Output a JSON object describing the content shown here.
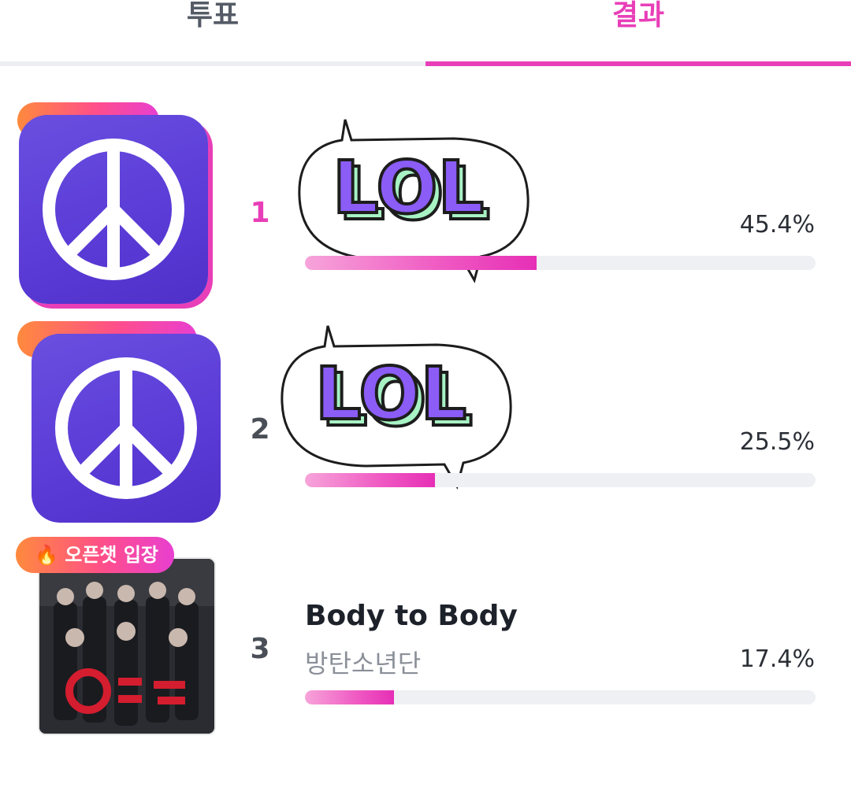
{
  "tabs": {
    "vote_label": "투표",
    "result_label": "결과",
    "active": "결과"
  },
  "results": [
    {
      "rank": "1",
      "title_sticker_text": "LOL",
      "percent_text": "45.4%",
      "percent_value": 45.4
    },
    {
      "rank": "2",
      "title_sticker_text": "LOL",
      "percent_text": "25.5%",
      "percent_value": 25.5
    },
    {
      "rank": "3",
      "badge": "🔥 오픈챗 입장",
      "title": "Body to Body",
      "artist": "방탄소년단",
      "percent_text": "17.4%",
      "percent_value": 17.4
    }
  ],
  "colors": {
    "accent": "#e83fb8",
    "app_icon": "#5a3bd6",
    "sticker_purple": "#8b5cf6",
    "sticker_green": "#a7f3c4",
    "track": "#eef0f3"
  },
  "icons": {
    "app_icon": "peace-sign-icon",
    "badge_icon": "fire-icon"
  }
}
